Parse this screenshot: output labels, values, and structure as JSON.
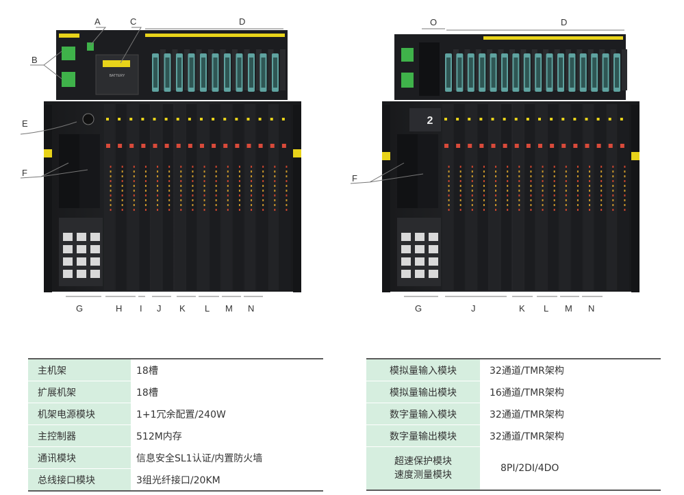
{
  "diagram": {
    "left_callouts": [
      "A",
      "B",
      "C",
      "D",
      "E",
      "F",
      "G",
      "H",
      "I",
      "J",
      "K",
      "L",
      "M",
      "N"
    ],
    "right_callouts": [
      "O",
      "D",
      "F",
      "G",
      "J",
      "K",
      "L",
      "M",
      "N"
    ],
    "rack_labels": {
      "battery": "BATTERY",
      "expansion_number": "2"
    }
  },
  "spec_left": [
    {
      "key": "主机架",
      "value": "18槽"
    },
    {
      "key": "扩展机架",
      "value": "18槽"
    },
    {
      "key": "机架电源模块",
      "value": "1+1冗余配置/240W"
    },
    {
      "key": "主控制器",
      "value": "512M内存"
    },
    {
      "key": "通讯模块",
      "value": "信息安全SL1认证/内置防火墙"
    },
    {
      "key": "总线接口模块",
      "value": "3组光纤接口/20KM"
    }
  ],
  "spec_right": [
    {
      "key": "模拟量输入模块",
      "value": "32通道/TMR架构"
    },
    {
      "key": "模拟量输出模块",
      "value": "16通道/TMR架构"
    },
    {
      "key": "数字量输入模块",
      "value": "32通道/TMR架构"
    },
    {
      "key": "数字量输出模块",
      "value": "32通道/TMR架构"
    },
    {
      "key_line1": "超速保护模块",
      "key_line2": "速度测量模块",
      "value": "8PI/2DI/4DO"
    }
  ],
  "colors": {
    "table_key_bg": "#d6eedf",
    "rack_body": "#1e1f21",
    "accent_yellow": "#e8d31a",
    "terminal_green": "#3fb24a",
    "connector_teal": "#5fa3a0"
  }
}
